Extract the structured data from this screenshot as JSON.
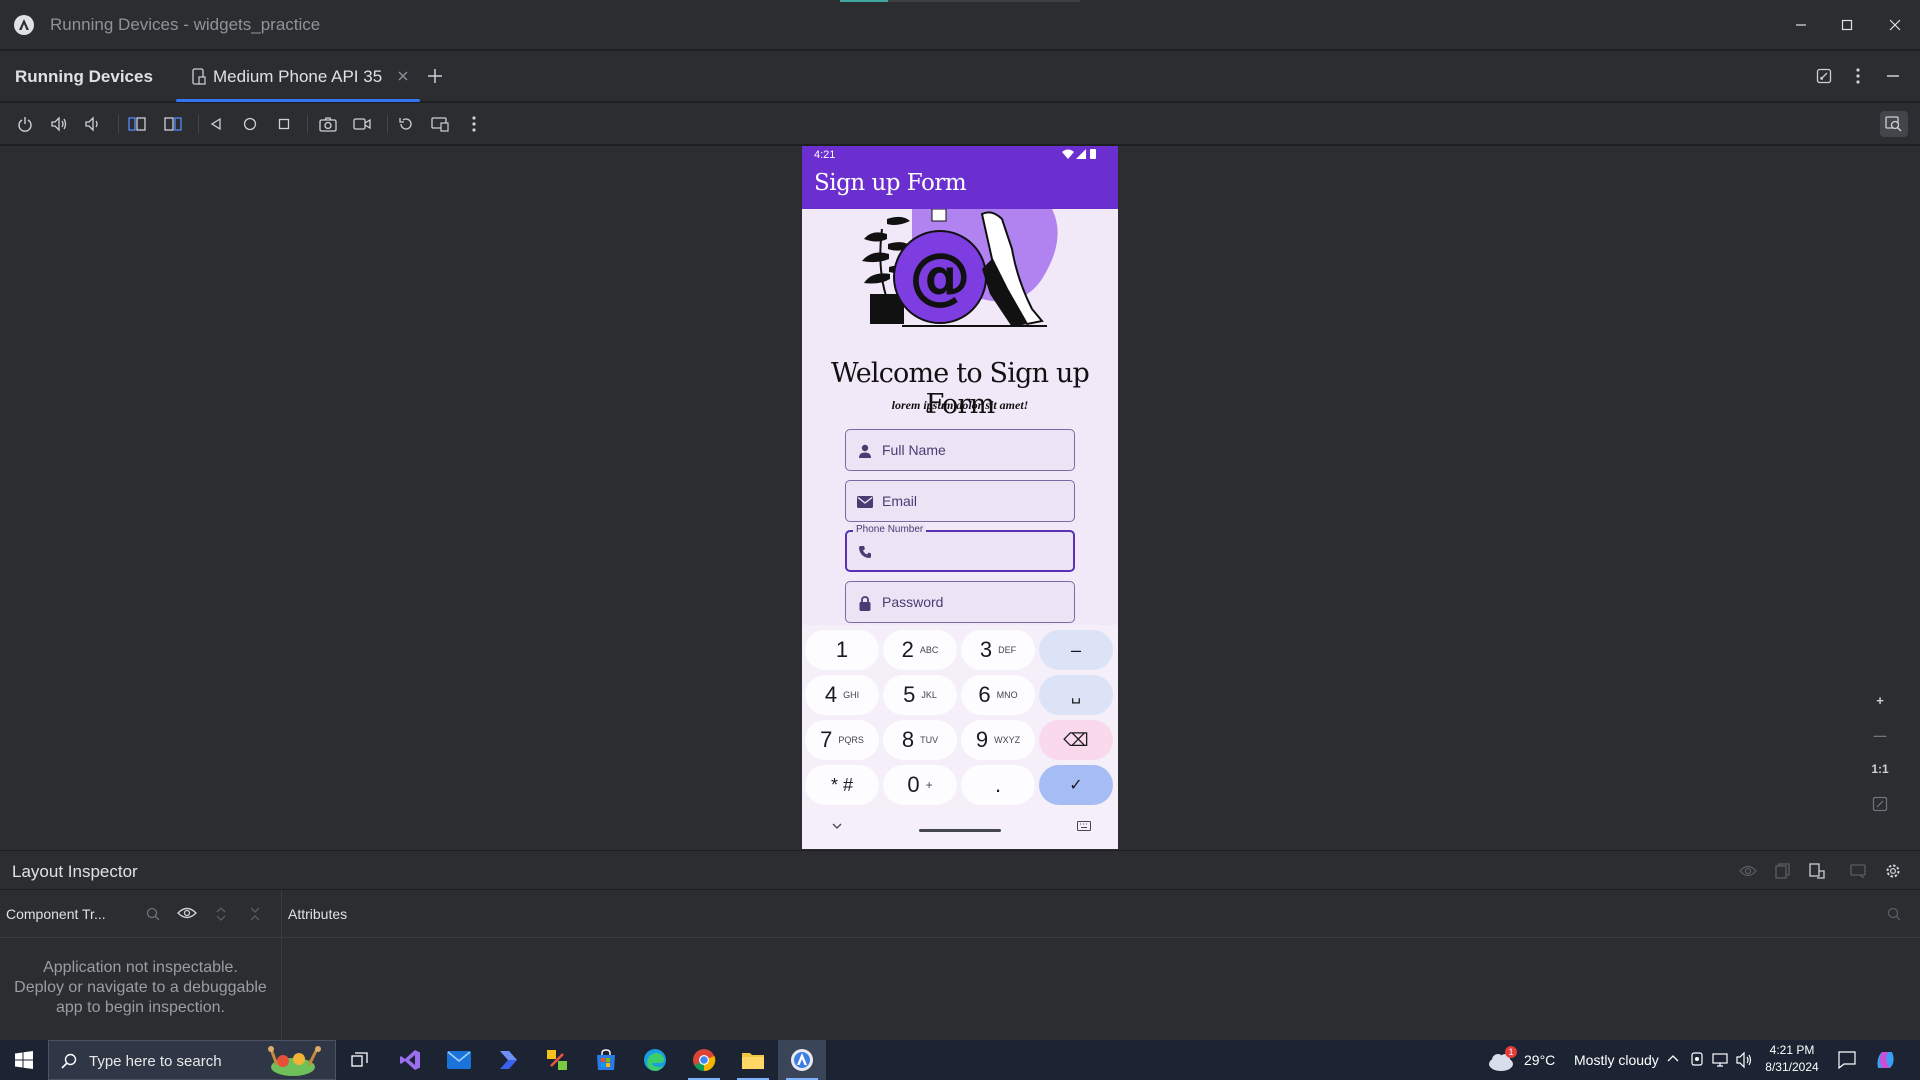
{
  "window": {
    "title": "Running Devices - widgets_practice",
    "minimize_icon": "minimize-icon",
    "maximize_icon": "maximize-icon",
    "close_icon": "close-icon"
  },
  "running_devices": {
    "title": "Running Devices",
    "tab_label": "Medium Phone API 35",
    "accent_color": "#3574f0"
  },
  "phone": {
    "status_time": "4:21",
    "app_title": "Sign up Form",
    "app_bar_color": "#6b2fcf",
    "welcome_title": "Welcome to Sign up Form",
    "subtitle": "lorem ipsum dolor sit amet!",
    "fields": [
      {
        "label": "Full Name",
        "icon": "person-icon"
      },
      {
        "label": "Email",
        "icon": "mail-icon"
      },
      {
        "label": "Phone Number",
        "icon": "phone-icon",
        "active": true
      },
      {
        "label": "Password",
        "icon": "lock-icon"
      }
    ],
    "keyboard": {
      "keys": [
        {
          "main": "1",
          "sub": ""
        },
        {
          "main": "2",
          "sub": "ABC"
        },
        {
          "main": "3",
          "sub": "DEF"
        },
        {
          "main": "–",
          "sub": ""
        },
        {
          "main": "4",
          "sub": "GHI"
        },
        {
          "main": "5",
          "sub": "JKL"
        },
        {
          "main": "6",
          "sub": "MNO"
        },
        {
          "main": "␣",
          "sub": ""
        },
        {
          "main": "7",
          "sub": "PQRS"
        },
        {
          "main": "8",
          "sub": "TUV"
        },
        {
          "main": "9",
          "sub": "WXYZ"
        },
        {
          "main": "⌫",
          "sub": ""
        },
        {
          "main": "* #",
          "sub": ""
        },
        {
          "main": "0",
          "sub": "+"
        },
        {
          "main": ".",
          "sub": ""
        },
        {
          "main": "✓",
          "sub": ""
        }
      ]
    }
  },
  "zoom": {
    "zoom_in": "+",
    "zoom_out": "—",
    "one_to_one": "1:1"
  },
  "layout_inspector": {
    "title": "Layout Inspector",
    "component_tree_label": "Component Tr...",
    "attributes_label": "Attributes",
    "message_line1": "Application not inspectable.",
    "message_line2": "Deploy or navigate to a debuggable",
    "message_line3": "app to begin inspection."
  },
  "taskbar": {
    "search_placeholder": "Type here to search",
    "weather_temp": "29°C",
    "weather_desc": "Mostly cloudy",
    "weather_badge": "1",
    "time": "4:21 PM",
    "date": "8/31/2024"
  }
}
